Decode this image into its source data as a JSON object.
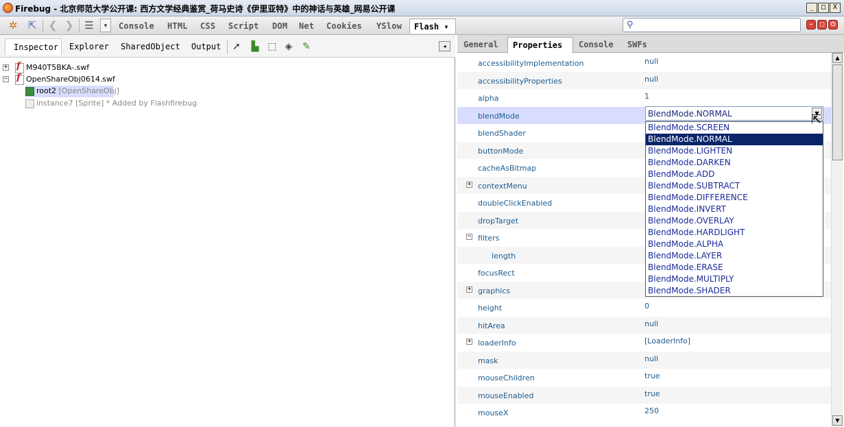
{
  "window": {
    "title": "Firebug - 北京师范大学公开课: 西方文学经典鉴赏_荷马史诗《伊里亚特》中的神话与英雄_网易公开课",
    "controls": {
      "minimize": "_",
      "maximize": "□",
      "close": "X"
    }
  },
  "toolbar": {
    "tabs": [
      "Console",
      "HTML",
      "CSS",
      "Script",
      "DOM",
      "Net",
      "Cookies",
      "YSlow"
    ],
    "active_tab": "Flash",
    "active_arrow": "▾",
    "search": {
      "value": "",
      "placeholder": ""
    }
  },
  "left_panel": {
    "tabs": [
      "Inspector",
      "Explorer",
      "SharedObject",
      "Output"
    ],
    "active_tab": "Inspector",
    "tree": [
      {
        "expander": "+",
        "label": "M940T5BKA-.swf",
        "detail": ""
      },
      {
        "expander": "−",
        "label": "OpenShareObj0614.swf",
        "detail": ""
      },
      {
        "expander": "",
        "label": "root2",
        "detail": "[OpenShareObj]"
      },
      {
        "expander": "",
        "label": "instance7",
        "detail": "[Sprite] * Added by Flashfirebug"
      }
    ]
  },
  "right_panel": {
    "tabs": [
      "General",
      "Properties",
      "Console",
      "SWFs"
    ],
    "active_tab": "Properties",
    "properties": [
      {
        "expander": "",
        "name": "accessibilityImplementation",
        "value": "null"
      },
      {
        "expander": "",
        "name": "accessibilityProperties",
        "value": "null"
      },
      {
        "expander": "",
        "name": "alpha",
        "value": "1"
      },
      {
        "expander": "",
        "name": "blendMode",
        "value": ""
      },
      {
        "expander": "",
        "name": "blendShader",
        "value": ""
      },
      {
        "expander": "",
        "name": "buttonMode",
        "value": ""
      },
      {
        "expander": "",
        "name": "cacheAsBitmap",
        "value": ""
      },
      {
        "expander": "+",
        "name": "contextMenu",
        "value": ""
      },
      {
        "expander": "",
        "name": "doubleClickEnabled",
        "value": ""
      },
      {
        "expander": "",
        "name": "dropTarget",
        "value": ""
      },
      {
        "expander": "−",
        "name": "filters",
        "value": ""
      },
      {
        "expander": "",
        "name": "length",
        "value": ""
      },
      {
        "expander": "",
        "name": "focusRect",
        "value": ""
      },
      {
        "expander": "+",
        "name": "graphics",
        "value": ""
      },
      {
        "expander": "",
        "name": "height",
        "value": "0"
      },
      {
        "expander": "",
        "name": "hitArea",
        "value": "null"
      },
      {
        "expander": "+",
        "name": "loaderInfo",
        "value": "[LoaderInfo]"
      },
      {
        "expander": "",
        "name": "mask",
        "value": "null"
      },
      {
        "expander": "",
        "name": "mouseChildren",
        "value": "true"
      },
      {
        "expander": "",
        "name": "mouseEnabled",
        "value": "true"
      },
      {
        "expander": "",
        "name": "mouseX",
        "value": "250"
      }
    ],
    "blend_select": {
      "value": "BlendMode.NORMAL",
      "options": [
        "BlendMode.SCREEN",
        "BlendMode.NORMAL",
        "BlendMode.LIGHTEN",
        "BlendMode.DARKEN",
        "BlendMode.ADD",
        "BlendMode.SUBTRACT",
        "BlendMode.DIFFERENCE",
        "BlendMode.INVERT",
        "BlendMode.OVERLAY",
        "BlendMode.HARDLIGHT",
        "BlendMode.ALPHA",
        "BlendMode.LAYER",
        "BlendMode.ERASE",
        "BlendMode.MULTIPLY",
        "BlendMode.SHADER"
      ],
      "highlighted": "BlendMode.NORMAL"
    }
  },
  "colors": {
    "prop_text": "#1d5b8e",
    "selected_row": "#d8ddff",
    "highlight": "#0a246a"
  }
}
